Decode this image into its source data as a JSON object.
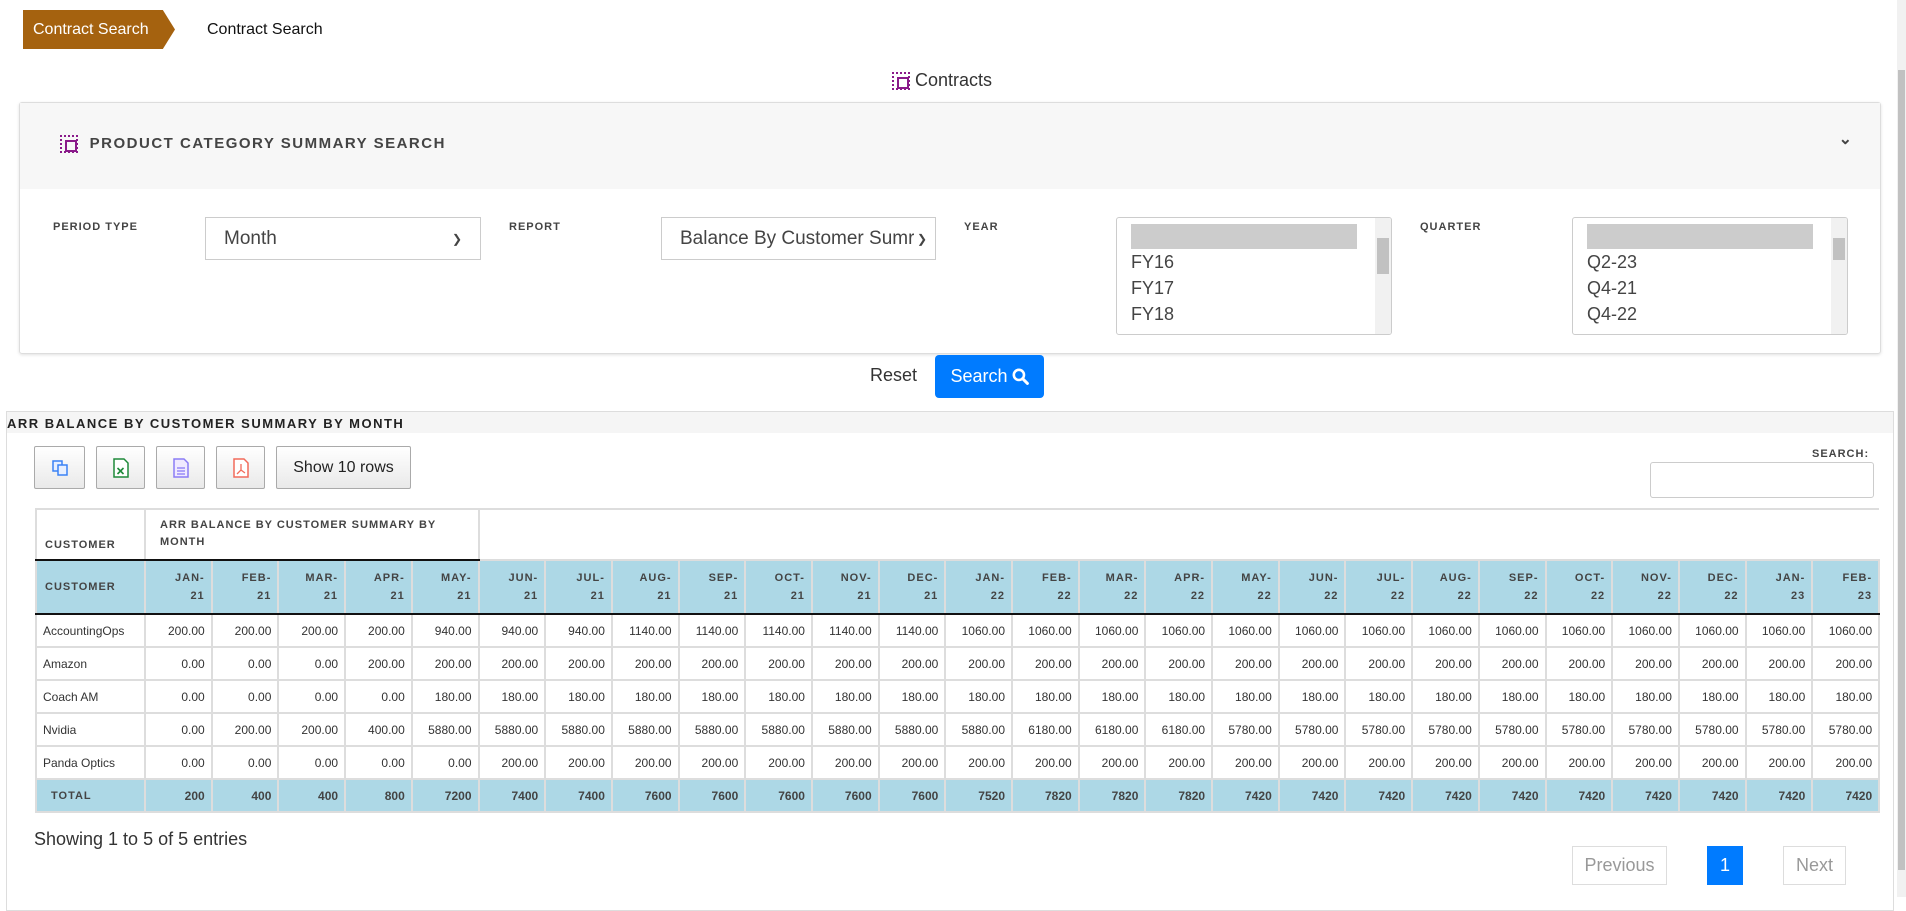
{
  "breadcrumb": {
    "items": [
      "Contract Search",
      "Contract Search"
    ]
  },
  "page_title": "Contracts",
  "search_panel": {
    "title": "PRODUCT CATEGORY SUMMARY SEARCH",
    "period_type": {
      "label": "PERIOD TYPE",
      "value": "Month"
    },
    "report": {
      "label": "REPORT",
      "value": "Balance By Customer Sumr"
    },
    "year": {
      "label": "YEAR",
      "options": [
        "",
        "FY16",
        "FY17",
        "FY18"
      ]
    },
    "quarter": {
      "label": "QUARTER",
      "options": [
        "",
        "Q2-23",
        "Q4-21",
        "Q4-22"
      ]
    },
    "reset_label": "Reset",
    "search_label": "Search"
  },
  "results": {
    "title": "ARR BALANCE BY CUSTOMER SUMMARY BY MONTH",
    "show_rows_label": "Show 10 rows",
    "search_label": "SEARCH:",
    "search_value": "",
    "group_header": {
      "customer": "CUSTOMER",
      "group": "ARR BALANCE BY CUSTOMER SUMMARY BY MONTH"
    },
    "columns": [
      "CUSTOMER",
      "JAN-21",
      "FEB-21",
      "MAR-21",
      "APR-21",
      "MAY-21",
      "JUN-21",
      "JUL-21",
      "AUG-21",
      "SEP-21",
      "OCT-21",
      "NOV-21",
      "DEC-21",
      "JAN-22",
      "FEB-22",
      "MAR-22",
      "APR-22",
      "MAY-22",
      "JUN-22",
      "JUL-22",
      "AUG-22",
      "SEP-22",
      "OCT-22",
      "NOV-22",
      "DEC-22",
      "JAN-23",
      "FEB-23"
    ],
    "rows": [
      [
        "AccountingOps",
        "200.00",
        "200.00",
        "200.00",
        "200.00",
        "940.00",
        "940.00",
        "940.00",
        "1140.00",
        "1140.00",
        "1140.00",
        "1140.00",
        "1140.00",
        "1060.00",
        "1060.00",
        "1060.00",
        "1060.00",
        "1060.00",
        "1060.00",
        "1060.00",
        "1060.00",
        "1060.00",
        "1060.00",
        "1060.00",
        "1060.00",
        "1060.00",
        "1060.00"
      ],
      [
        "Amazon",
        "0.00",
        "0.00",
        "0.00",
        "200.00",
        "200.00",
        "200.00",
        "200.00",
        "200.00",
        "200.00",
        "200.00",
        "200.00",
        "200.00",
        "200.00",
        "200.00",
        "200.00",
        "200.00",
        "200.00",
        "200.00",
        "200.00",
        "200.00",
        "200.00",
        "200.00",
        "200.00",
        "200.00",
        "200.00",
        "200.00"
      ],
      [
        "Coach AM",
        "0.00",
        "0.00",
        "0.00",
        "0.00",
        "180.00",
        "180.00",
        "180.00",
        "180.00",
        "180.00",
        "180.00",
        "180.00",
        "180.00",
        "180.00",
        "180.00",
        "180.00",
        "180.00",
        "180.00",
        "180.00",
        "180.00",
        "180.00",
        "180.00",
        "180.00",
        "180.00",
        "180.00",
        "180.00",
        "180.00"
      ],
      [
        "Nvidia",
        "0.00",
        "200.00",
        "200.00",
        "400.00",
        "5880.00",
        "5880.00",
        "5880.00",
        "5880.00",
        "5880.00",
        "5880.00",
        "5880.00",
        "5880.00",
        "5880.00",
        "6180.00",
        "6180.00",
        "6180.00",
        "5780.00",
        "5780.00",
        "5780.00",
        "5780.00",
        "5780.00",
        "5780.00",
        "5780.00",
        "5780.00",
        "5780.00",
        "5780.00"
      ],
      [
        "Panda Optics",
        "0.00",
        "0.00",
        "0.00",
        "0.00",
        "0.00",
        "200.00",
        "200.00",
        "200.00",
        "200.00",
        "200.00",
        "200.00",
        "200.00",
        "200.00",
        "200.00",
        "200.00",
        "200.00",
        "200.00",
        "200.00",
        "200.00",
        "200.00",
        "200.00",
        "200.00",
        "200.00",
        "200.00",
        "200.00",
        "200.00"
      ]
    ],
    "total": [
      "TOTAL",
      "200",
      "400",
      "400",
      "800",
      "7200",
      "7400",
      "7400",
      "7600",
      "7600",
      "7600",
      "7600",
      "7600",
      "7520",
      "7820",
      "7820",
      "7820",
      "7420",
      "7420",
      "7420",
      "7420",
      "7420",
      "7420",
      "7420",
      "7420",
      "7420",
      "7420"
    ],
    "info": "Showing 1 to 5 of 5 entries",
    "pagination": {
      "previous": "Previous",
      "current": "1",
      "next": "Next"
    }
  },
  "colors": {
    "breadcrumb": "#a5620f",
    "primary": "#007bff",
    "table_header": "#add8e6",
    "icon_purple": "#8a1a8a"
  },
  "icons": [
    "contracts-icon",
    "collapse-chevron-icon",
    "search-icon",
    "copy-icon",
    "excel-icon",
    "csv-icon",
    "pdf-icon"
  ]
}
